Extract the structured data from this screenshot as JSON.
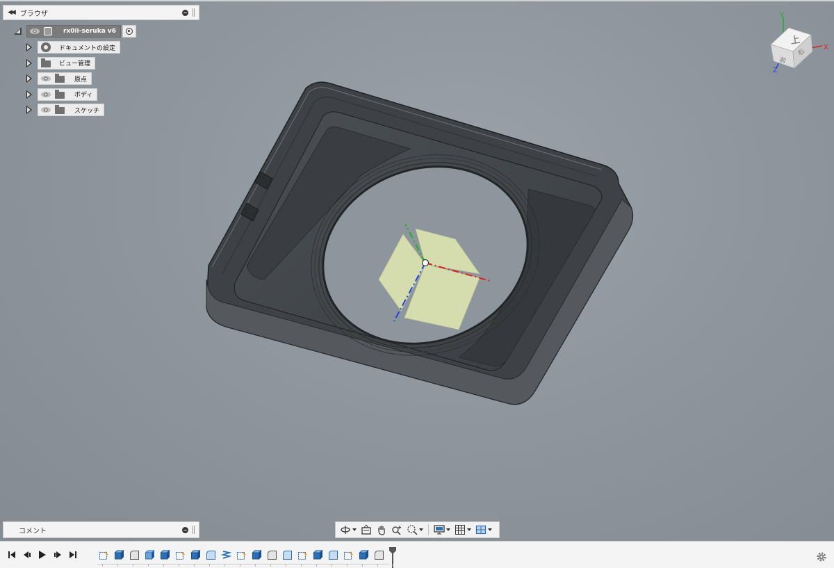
{
  "browser": {
    "title": "ブラウザ",
    "root": {
      "label": "rx0ii-seruka v6"
    },
    "items": [
      {
        "label": "ドキュメントの設定",
        "icon": "gear-icon",
        "has_eye": false
      },
      {
        "label": "ビュー管理",
        "icon": "folder-icon",
        "has_eye": false
      },
      {
        "label": "原点",
        "icon": "folder-icon",
        "has_eye": true
      },
      {
        "label": "ボディ",
        "icon": "folder-icon",
        "has_eye": true
      },
      {
        "label": "スケッチ",
        "icon": "folder-icon",
        "has_eye": true
      }
    ]
  },
  "comments": {
    "title": "コメント"
  },
  "viewcube": {
    "face_top": "上",
    "face_front": "前",
    "face_right": "右",
    "axis_y": "Y",
    "axis_x": "X",
    "axis_z": "Z"
  },
  "nav_toolbar": {
    "buttons": [
      "orbit-icon",
      "look-at-icon",
      "pan-icon",
      "zoom-icon",
      "fit-icon",
      "display-settings-icon",
      "grid-icon",
      "viewports-icon"
    ]
  },
  "timeline": {
    "controls": [
      "skip-start-icon",
      "step-back-icon",
      "play-icon",
      "step-forward-icon",
      "skip-end-icon"
    ],
    "features": [
      "sketch",
      "extrude",
      "fillet",
      "shell",
      "extrude",
      "sketch",
      "extrude",
      "chamfer",
      "offset",
      "sketch",
      "extrude",
      "fillet",
      "chamfer",
      "sketch",
      "extrude",
      "chamfer",
      "sketch",
      "extrude",
      "fillet"
    ]
  },
  "colors": {
    "viewport_bg": "#8e979d",
    "axis_x": "#e02020",
    "axis_y": "#20b020",
    "axis_z": "#2040e0",
    "origin_plane": "#e8eeb0"
  }
}
